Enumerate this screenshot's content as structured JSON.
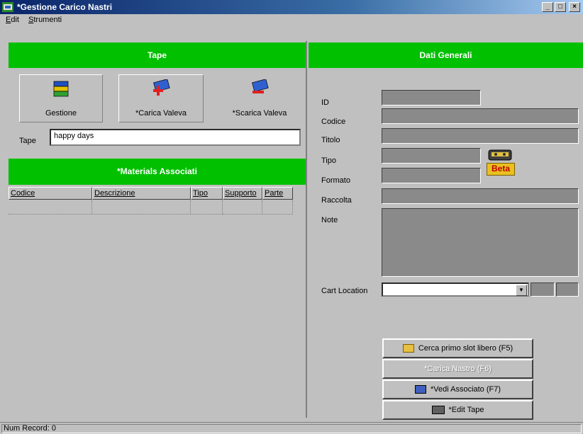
{
  "window": {
    "title": "*Gestione Carico Nastri"
  },
  "menu": {
    "items": [
      {
        "label": "Edit",
        "u": "E",
        "rest": "dit"
      },
      {
        "label": "Strumenti",
        "u": "S",
        "rest": "trumenti"
      }
    ]
  },
  "left": {
    "header": "Tape",
    "buttons": [
      {
        "label": "Gestione",
        "icon": "tape-stack-icon"
      },
      {
        "label": "*Carica Valeva",
        "icon": "tape-add-icon"
      },
      {
        "label": "*Scarica Valeva",
        "icon": "tape-remove-icon"
      }
    ],
    "tape_label": "Tape",
    "tape_value": "happy days",
    "materials_header": "*Materials Associati",
    "grid_columns": [
      "Codice",
      "Descrizione",
      "Tipo",
      "Supporto",
      "Parte"
    ]
  },
  "right": {
    "header": "Dati Generali",
    "fields": {
      "id_label": "ID",
      "codice_label": "Codice",
      "titolo_label": "Titolo",
      "tipo_label": "Tipo",
      "formato_label": "Formato",
      "raccolta_label": "Raccolta",
      "note_label": "Note",
      "cart_location_label": "Cart Location"
    },
    "beta_badge": "Beta",
    "buttons": {
      "cerca": "Cerca primo slot libero (F5)",
      "disabled": "*Carica Nastro (F6)",
      "vedi": "*Vedi Associato (F7)",
      "edit": "*Edit Tape"
    }
  },
  "status": {
    "text": "Num Record: 0"
  },
  "colors": {
    "green_header": "#00c000",
    "titlebar": "#0a246a",
    "face": "#c0c0c0"
  }
}
